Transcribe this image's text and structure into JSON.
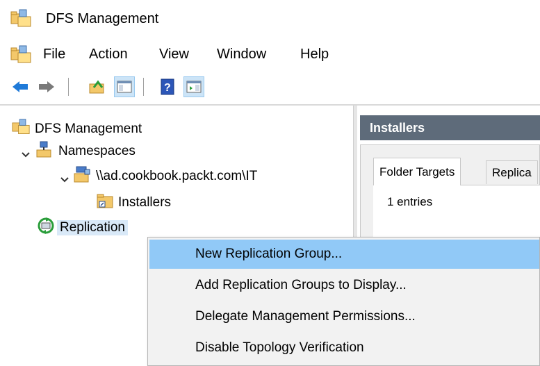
{
  "window": {
    "title": "DFS Management"
  },
  "menubar": {
    "items": [
      "File",
      "Action",
      "View",
      "Window",
      "Help"
    ]
  },
  "toolbar": {
    "buttons": [
      "back-arrow-icon",
      "forward-arrow-icon",
      "up-folder-icon",
      "show-hide-console-tree-icon",
      "help-icon",
      "show-hide-action-pane-icon"
    ]
  },
  "tree": {
    "root": "DFS Management",
    "namespaces": "Namespaces",
    "namespace_path": "\\\\ad.cookbook.packt.com\\IT",
    "folder": "Installers",
    "replication": "Replication"
  },
  "right_pane": {
    "header": "Installers",
    "tabs": [
      "Folder Targets",
      "Replica"
    ],
    "entries_text": "1 entries"
  },
  "context_menu": {
    "items": [
      "New Replication Group...",
      "Add Replication Groups to Display...",
      "Delegate Management Permissions...",
      "Disable Topology Verification"
    ],
    "highlighted_index": 0
  },
  "colors": {
    "header_bg": "#5e6b7a",
    "highlight": "#91c9f7",
    "selection": "#d9e9f8"
  }
}
